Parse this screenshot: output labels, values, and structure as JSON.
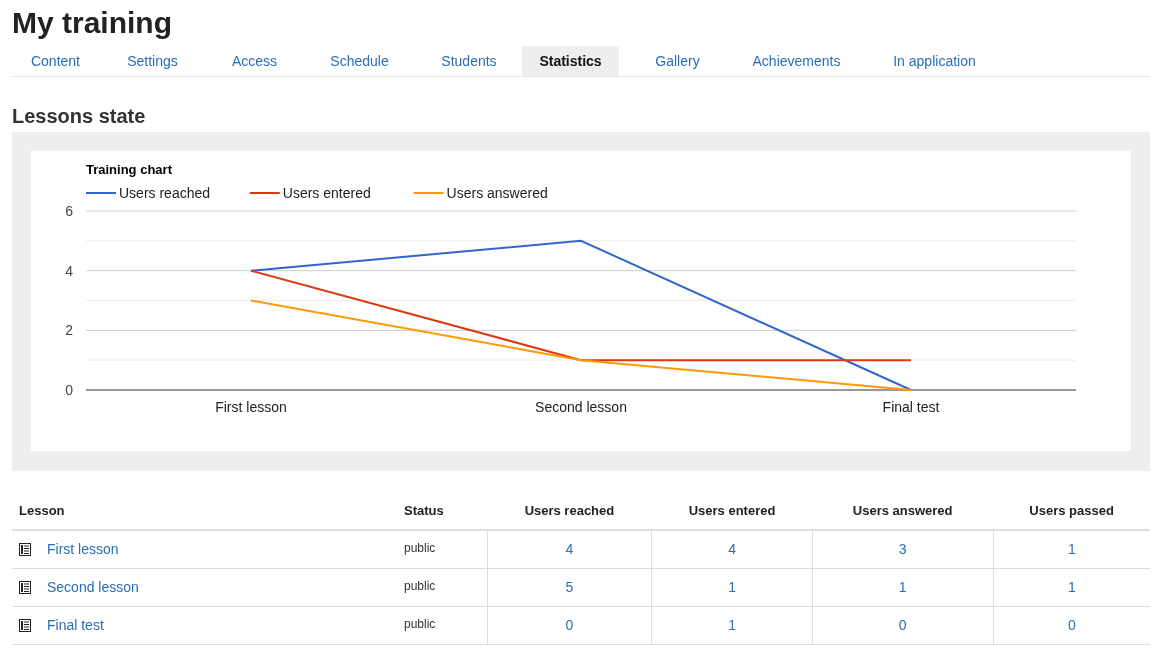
{
  "title": "My training",
  "tabs": [
    {
      "label": "Content",
      "selected": false
    },
    {
      "label": "Settings",
      "selected": false
    },
    {
      "label": "Access",
      "selected": false
    },
    {
      "label": "Schedule",
      "selected": false
    },
    {
      "label": "Students",
      "selected": false
    },
    {
      "label": "Statistics",
      "selected": true
    },
    {
      "label": "Gallery",
      "selected": false
    },
    {
      "label": "Achievements",
      "selected": false
    },
    {
      "label": "In application",
      "selected": false
    }
  ],
  "section_title": "Lessons state",
  "chart": {
    "chart_data": {
      "type": "line",
      "title": "Training chart",
      "legend": "top",
      "categories": [
        "First lesson",
        "Second lesson",
        "Final test"
      ],
      "ylim": [
        0,
        6
      ],
      "yticks": [
        0,
        2,
        4,
        6
      ],
      "series": [
        {
          "name": "Users reached",
          "color": "#3366cc",
          "values": [
            4,
            5,
            0
          ]
        },
        {
          "name": "Users entered",
          "color": "#dc3912",
          "values": [
            4,
            1,
            1
          ]
        },
        {
          "name": "Users answered",
          "color": "#ff9900",
          "values": [
            3,
            1,
            0
          ]
        }
      ]
    }
  },
  "table": {
    "columns": [
      "Lesson",
      "Status",
      "Users reached",
      "Users entered",
      "Users answered",
      "Users passed"
    ],
    "rows": [
      {
        "lesson": "First lesson",
        "status": "public",
        "reached": "4",
        "entered": "4",
        "answered": "3",
        "passed": "1"
      },
      {
        "lesson": "Second lesson",
        "status": "public",
        "reached": "5",
        "entered": "1",
        "answered": "1",
        "passed": "1"
      },
      {
        "lesson": "Final test",
        "status": "public",
        "reached": "0",
        "entered": "1",
        "answered": "0",
        "passed": "0"
      }
    ]
  }
}
